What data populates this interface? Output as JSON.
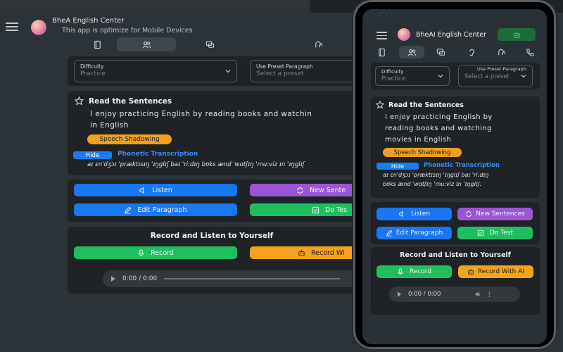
{
  "app": {
    "title": "BheAI English Center",
    "desktop_title": "BheA  English Center",
    "subtitle": "This app is optimize for Mobile Devices"
  },
  "tabs": [
    {
      "icon": "book-icon"
    },
    {
      "icon": "users-icon"
    },
    {
      "icon": "chat-icon"
    },
    {
      "icon": "ear-icon"
    },
    {
      "icon": "speech-icon"
    },
    {
      "icon": "phone-icon"
    }
  ],
  "difficulty": {
    "label": "Difficulty",
    "value": "Practice"
  },
  "preset": {
    "label": "Use Preset Paragraph",
    "placeholder": "Select a preset"
  },
  "read_section": {
    "title": "Read the Sentences",
    "sentence": "I enjoy practicing English by reading books and watching movies in English",
    "desktop_sentence_line1": "I  enjoy  practicing  English  by  reading  books  and  watchin",
    "desktop_sentence_line2": "in  English",
    "mobile_sentence_line1": "I  enjoy  practicing  English  by",
    "mobile_sentence_line2": "reading  books  and  watching",
    "mobile_sentence_line3": "movies  in  English",
    "badge": "Speech Shadowing",
    "hide_label": "Hide",
    "phonetic_label": "Phonetic Transcription",
    "phonetic_text_desktop": "aɪ ɛn'dʒɔɪ 'præktɪsɪŋ 'ɪŋglɪʃ baɪ 'ri:dɪŋ bʊks ænd 'wɑtʃɪŋ 'mu:viz ɪn 'ɪŋglɪʃ",
    "phonetic_text_line1": "aɪ ɛn'dʒɔɪ 'præktɪsɪŋ 'ɪŋglɪʃ baɪ 'ri:dɪŋ",
    "phonetic_text_line2": "bʊks ænd 'wɑtʃɪŋ 'mu:viz ɪn 'ɪŋglɪʃ."
  },
  "actions": {
    "listen": "Listen",
    "new_sentences": "New Sentences",
    "new_sentences_desktop": "New Sente",
    "edit_paragraph": "Edit Paragraph",
    "do_test": "Do Test",
    "do_test_desktop": "Do Tes"
  },
  "record_section": {
    "title": "Record and Listen to Yourself",
    "record": "Record",
    "record_ai": "Record With AI",
    "record_ai_desktop": "Record Wi",
    "time": "0:00 / 0:00"
  },
  "colors": {
    "blue": "#1877f2",
    "purple": "#9a56d6",
    "green": "#1fbf5f",
    "orange": "#f5a31a",
    "panel": "#1f2326",
    "bg": "#2b3238"
  }
}
